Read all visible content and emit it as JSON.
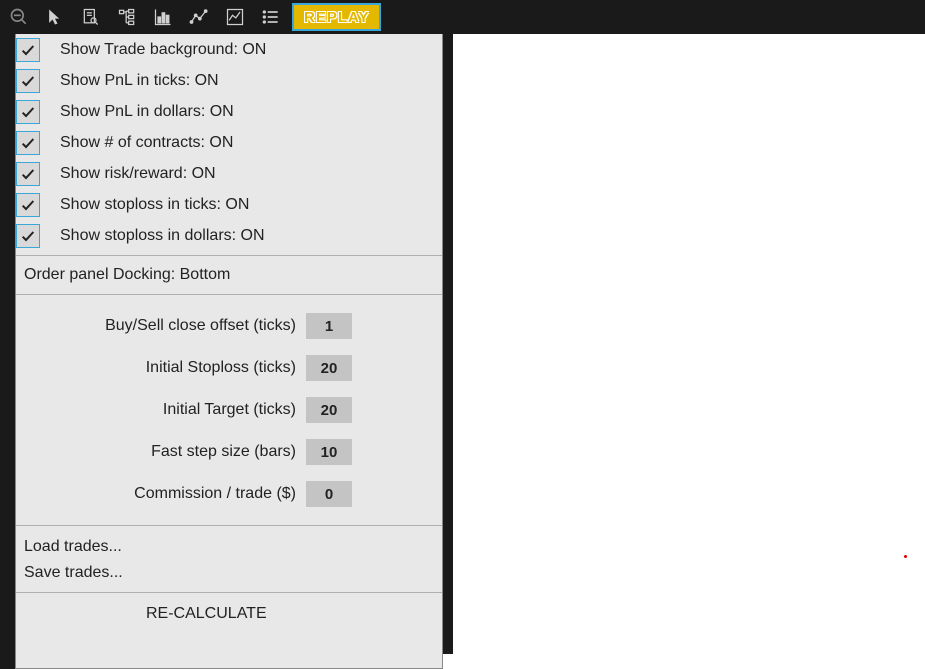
{
  "toolbar": {
    "replay_label": "REPLAY"
  },
  "checks": [
    {
      "label": "Show Trade background: ON"
    },
    {
      "label": "Show PnL in ticks: ON"
    },
    {
      "label": "Show PnL in dollars: ON"
    },
    {
      "label": "Show # of contracts: ON"
    },
    {
      "label": "Show risk/reward: ON"
    },
    {
      "label": "Show stoploss in ticks: ON"
    },
    {
      "label": "Show stoploss in dollars: ON"
    }
  ],
  "docking": {
    "label": "Order panel  Docking: Bottom"
  },
  "numeric": [
    {
      "label": "Buy/Sell close offset (ticks)",
      "value": "1"
    },
    {
      "label": "Initial Stoploss (ticks)",
      "value": "20"
    },
    {
      "label": "Initial Target (ticks)",
      "value": "20"
    },
    {
      "label": "Fast step size (bars)",
      "value": "10"
    },
    {
      "label": "Commission / trade ($)",
      "value": "0"
    }
  ],
  "actions": {
    "load": "Load trades...",
    "save": "Save trades..."
  },
  "recalculate": "RE-CALCULATE"
}
